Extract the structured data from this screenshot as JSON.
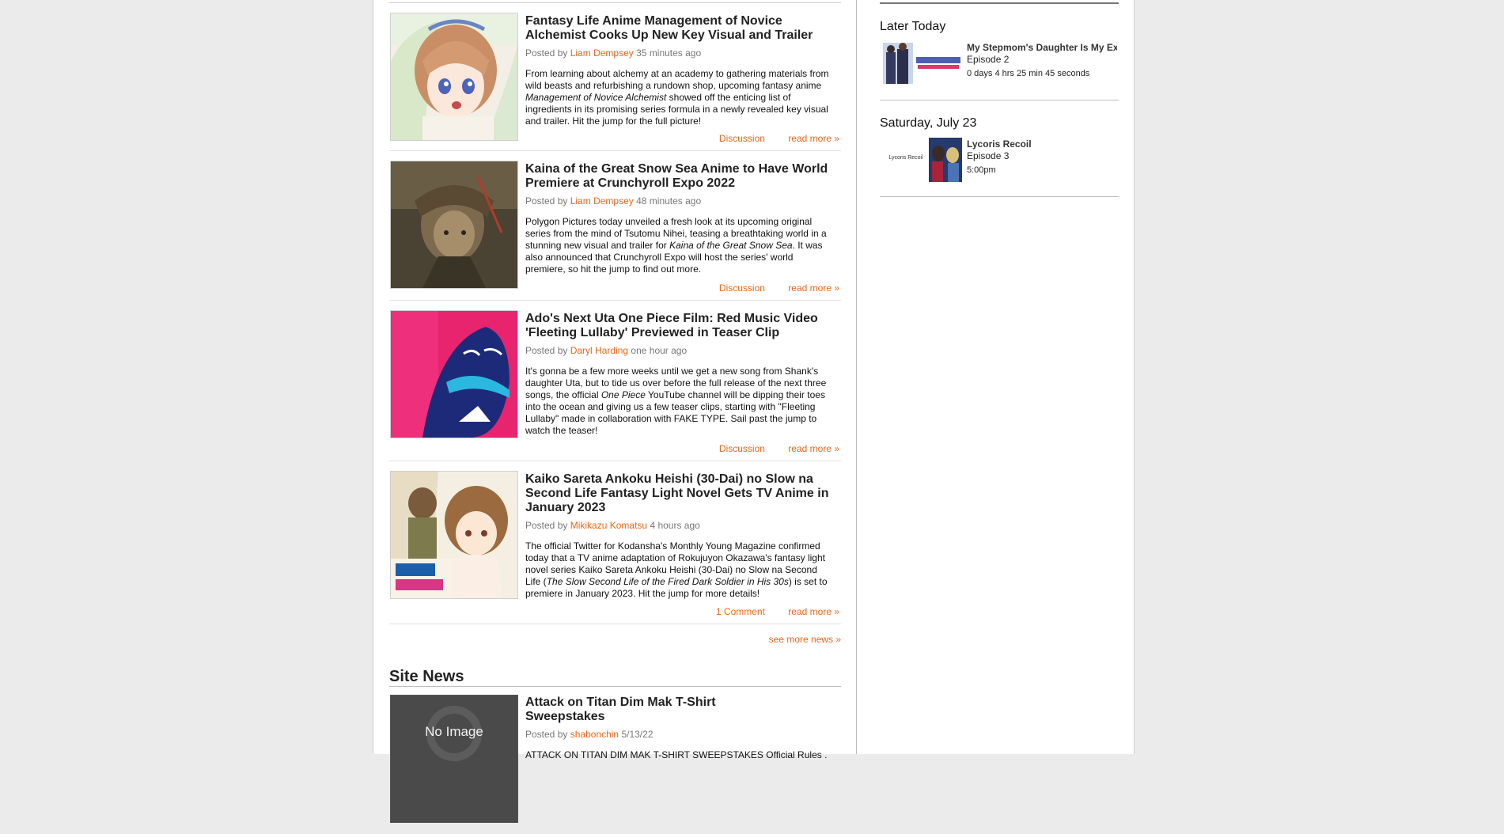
{
  "main": {
    "articles": [
      {
        "title": "Fantasy Life Anime Management of Novice Alchemist Cooks Up New Key Visual and Trailer",
        "posted_prefix": "Posted by",
        "author": "Liam Dempsey",
        "time": "35 minutes ago",
        "excerpt_a": "From learning about alchemy at an academy to gathering materials from wild beasts and refurbishing a rundown shop, upcoming fantasy anime ",
        "excerpt_em": "Management of Novice Alchemist",
        "excerpt_b": " showed off the enticing list of ingredients in its promising series formula in a newly revealed key visual and trailer. Hit the jump for the full picture!",
        "discussion": "Discussion",
        "read_more": "read more »"
      },
      {
        "title": "Kaina of the Great Snow Sea Anime to Have World Premiere at Crunchyroll Expo 2022",
        "posted_prefix": "Posted by",
        "author": "Liam Dempsey",
        "time": "48 minutes ago",
        "excerpt_a": "Polygon Pictures today unveiled a fresh look at its upcoming original series from the mind of Tsutomu Nihei, teasing a breathtaking world in a stunning new visual and trailer for ",
        "excerpt_em": "Kaina of the Great Snow Sea",
        "excerpt_b": ". It was also announced that Crunchyroll Expo will host the series' world premiere, so hit the jump to find out more.",
        "discussion": "Discussion",
        "read_more": "read more »"
      },
      {
        "title": "Ado's Next Uta One Piece Film: Red Music Video 'Fleeting Lullaby' Previewed in Teaser Clip",
        "posted_prefix": "Posted by",
        "author": "Daryl Harding",
        "time": "one hour ago",
        "excerpt_a": "It's gonna be a few more weeks until we get a new song from Shank's daughter Uta, but to tide us over before the full release of the next three songs, the official ",
        "excerpt_em": "One Piece",
        "excerpt_b": " YouTube channel will be dipping their toes into the ocean and giving us a few teaser clips, starting with \"Fleeting Lullaby\" made in collaboration with FAKE TYPE. Sail past the jump to watch the teaser!",
        "discussion": "Discussion",
        "read_more": "read more »"
      },
      {
        "title": "Kaiko Sareta Ankoku Heishi (30-Dai) no Slow na Second Life Fantasy Light Novel Gets TV Anime in January 2023",
        "posted_prefix": "Posted by",
        "author": "Mikikazu Komatsu",
        "time": "4 hours ago",
        "excerpt_a": "The official Twitter for Kodansha's Monthly Young Magazine confirmed today that a TV anime adaptation of Rokujuyon Okazawa's fantasy light novel series Kaiko Sareta Ankoku Heishi (30-Dai) no Slow na Second Life (",
        "excerpt_em": "The Slow Second Life of the Fired Dark Soldier in His 30s",
        "excerpt_b": ") is set to premiere in January 2023. Hit the jump for more details!",
        "discussion": "1 Comment",
        "read_more": "read more »"
      }
    ],
    "see_more": "see more news »",
    "site_news": {
      "heading": "Site News",
      "article": {
        "title": "Attack on Titan Dim Mak T-Shirt Sweepstakes",
        "posted_prefix": "Posted by",
        "author": "shabonchin",
        "time": "5/13/22",
        "no_image": "No Image",
        "excerpt": "ATTACK ON TITAN DIM MAK T-SHIRT SWEEPSTAKES Official Rules ."
      }
    }
  },
  "sidebar": {
    "days": [
      {
        "title": "Later Today",
        "items": [
          {
            "show": "My Stepmom's Daughter Is My Ex",
            "episode": "Episode 2",
            "time": "0 days 4 hrs 25 min 45 seconds"
          }
        ]
      },
      {
        "title": "Saturday, July 23",
        "items": [
          {
            "show": "Lycoris Recoil",
            "episode": "Episode 3",
            "time": "5:00pm",
            "logo_text": "Lycoris Recoil"
          }
        ]
      }
    ]
  },
  "colors": {
    "accent": "#e8681a",
    "text": "#222222",
    "muted": "#777777",
    "background": "#ebebeb"
  }
}
